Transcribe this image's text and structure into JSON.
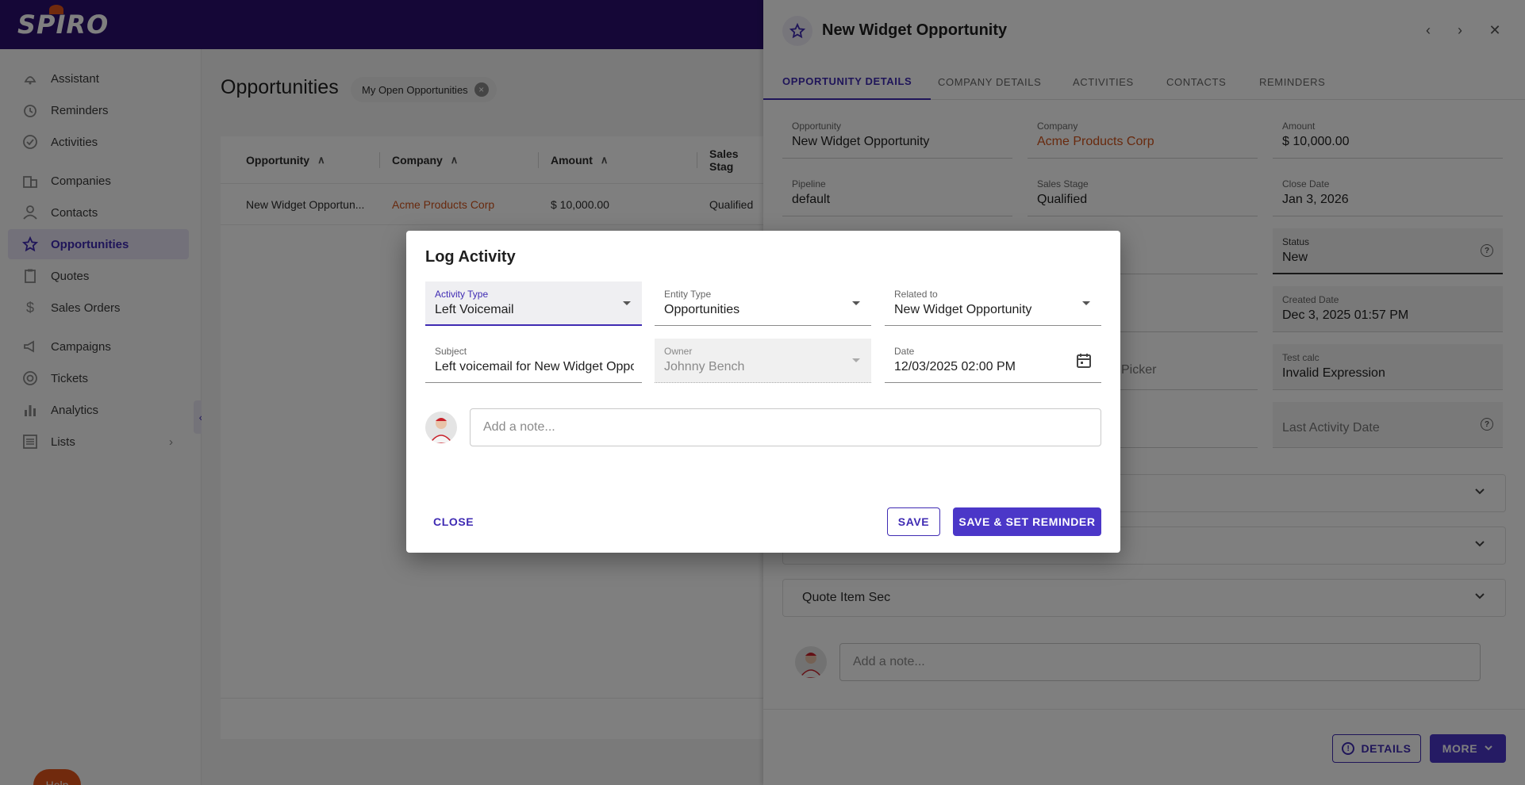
{
  "app": {
    "logo_text": "SPIRO"
  },
  "sidebar": {
    "items": [
      {
        "label": "Assistant",
        "icon": "assistant-icon"
      },
      {
        "label": "Reminders",
        "icon": "alarm-icon"
      },
      {
        "label": "Activities",
        "icon": "check-circle-icon"
      },
      {
        "label": "Companies",
        "icon": "building-icon"
      },
      {
        "label": "Contacts",
        "icon": "person-icon"
      },
      {
        "label": "Opportunities",
        "icon": "star-icon"
      },
      {
        "label": "Quotes",
        "icon": "clipboard-icon"
      },
      {
        "label": "Sales Orders",
        "icon": "dollar-icon"
      },
      {
        "label": "Campaigns",
        "icon": "megaphone-icon"
      },
      {
        "label": "Tickets",
        "icon": "support-icon"
      },
      {
        "label": "Analytics",
        "icon": "bar-chart-icon"
      },
      {
        "label": "Lists",
        "icon": "list-icon"
      }
    ],
    "help_label": "Help"
  },
  "main": {
    "title": "Opportunities",
    "filter_chip": "My Open Opportunities",
    "columns": [
      "Opportunity",
      "Company",
      "Amount",
      "Sales Stag"
    ],
    "rows": [
      {
        "opportunity": "New Widget Opportun...",
        "company": "Acme Products Corp",
        "amount": "$ 10,000.00",
        "stage": "Qualified"
      }
    ]
  },
  "panel": {
    "title": "New Widget Opportunity",
    "tabs": [
      "Opportunity Details",
      "Company Details",
      "Activities",
      "Contacts",
      "Reminders"
    ],
    "fields": {
      "opportunity": {
        "label": "Opportunity",
        "value": "New Widget Opportunity"
      },
      "company": {
        "label": "Company",
        "value": "Acme Products Corp"
      },
      "amount": {
        "label": "Amount",
        "value": "$ 10,000.00"
      },
      "pipeline": {
        "label": "Pipeline",
        "value": "default"
      },
      "sales_stage": {
        "label": "Sales Stage",
        "value": "Qualified"
      },
      "close_date": {
        "label": "Close Date",
        "value": "Jan 3, 2026"
      },
      "status": {
        "label": "Status",
        "value": "New"
      },
      "created_date": {
        "label": "Created Date",
        "value": "Dec 3, 2025 01:57 PM"
      },
      "test_calc": {
        "label": "Test calc",
        "value": "Invalid Expression"
      },
      "last_activity": {
        "placeholder": "Last Activity Date"
      },
      "picker_fragment": "Picker"
    },
    "sections": [
      "Quote Item Sec"
    ],
    "note_placeholder": "Add a note...",
    "details_button": "DETAILS",
    "more_button": "MORE"
  },
  "dialog": {
    "title": "Log Activity",
    "activity_type": {
      "label": "Activity Type",
      "value": "Left Voicemail"
    },
    "entity_type": {
      "label": "Entity Type",
      "value": "Opportunities"
    },
    "related_to": {
      "label": "Related to",
      "value": "New Widget Opportunity"
    },
    "subject": {
      "label": "Subject",
      "value": "Left voicemail for New Widget Opportunity"
    },
    "owner": {
      "label": "Owner",
      "value": "Johnny Bench"
    },
    "date": {
      "label": "Date",
      "value": "12/03/2025 02:00 PM"
    },
    "note_placeholder": "Add a note...",
    "close_label": "CLOSE",
    "save_label": "SAVE",
    "save_reminder_label": "SAVE & SET REMINDER"
  },
  "colors": {
    "brand": "#2a0f6e",
    "accent": "#4b37c8",
    "link": "#d0531b",
    "help": "#e2541b"
  }
}
